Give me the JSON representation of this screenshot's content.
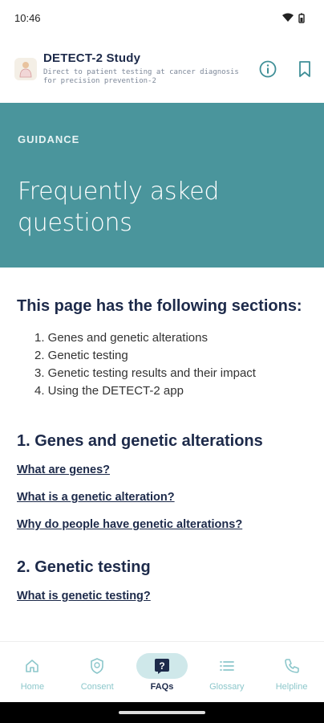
{
  "status": {
    "time": "10:46"
  },
  "header": {
    "title": "DETECT-2 Study",
    "subtitle": "Direct to patient testing at cancer diagnosis for precision prevention-2"
  },
  "hero": {
    "eyebrow": "GUIDANCE",
    "title": "Frequently asked questions"
  },
  "intro": {
    "heading": "This page has the following sections:",
    "items": [
      "1. Genes and genetic alterations",
      "2. Genetic testing",
      "3. Genetic testing results and their impact",
      "4. Using the DETECT-2 app"
    ]
  },
  "sections": [
    {
      "heading": "1. Genes and genetic alterations",
      "links": [
        "What are genes?",
        "What is a genetic alteration?",
        "Why do people have genetic alterations?"
      ]
    },
    {
      "heading": "2. Genetic testing",
      "links": [
        "What is genetic testing?"
      ]
    }
  ],
  "nav": {
    "items": [
      {
        "label": "Home",
        "icon": "home-icon"
      },
      {
        "label": "Consent",
        "icon": "shield-icon"
      },
      {
        "label": "FAQs",
        "icon": "question-icon",
        "active": true
      },
      {
        "label": "Glossary",
        "icon": "list-icon"
      },
      {
        "label": "Helpline",
        "icon": "phone-icon"
      }
    ]
  },
  "colors": {
    "accent": "#4a959c",
    "navy": "#1d2a4a",
    "nav_inactive": "#8cc7cb"
  }
}
